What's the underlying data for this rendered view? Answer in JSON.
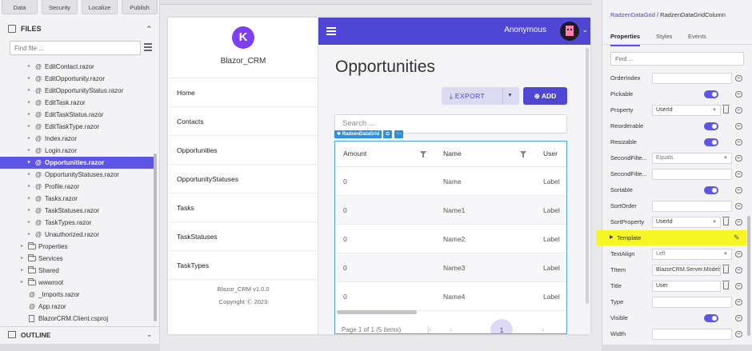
{
  "toolbar": {
    "data_label": "Data",
    "security_label": "Security",
    "localize_label": "Localize",
    "publish_label": "Publish"
  },
  "files": {
    "header": "FILES",
    "find_placeholder": "Find file ...",
    "items": [
      {
        "label": "EditContact.razor",
        "type": "razor"
      },
      {
        "label": "EditOpportunity.razor",
        "type": "razor"
      },
      {
        "label": "EditOpportunityStatus.razor",
        "type": "razor"
      },
      {
        "label": "EditTask.razor",
        "type": "razor"
      },
      {
        "label": "EditTaskStatus.razor",
        "type": "razor"
      },
      {
        "label": "EditTaskType.razor",
        "type": "razor"
      },
      {
        "label": "Index.razor",
        "type": "razor"
      },
      {
        "label": "Login.razor",
        "type": "razor"
      },
      {
        "label": "Opportunities.razor",
        "type": "razor",
        "selected": true
      },
      {
        "label": "OpportunityStatuses.razor",
        "type": "razor"
      },
      {
        "label": "Profile.razor",
        "type": "razor"
      },
      {
        "label": "Tasks.razor",
        "type": "razor"
      },
      {
        "label": "TaskStatuses.razor",
        "type": "razor"
      },
      {
        "label": "TaskTypes.razor",
        "type": "razor"
      },
      {
        "label": "Unauthorized.razor",
        "type": "razor"
      },
      {
        "label": "Properties",
        "type": "folder"
      },
      {
        "label": "Services",
        "type": "folder"
      },
      {
        "label": "Shared",
        "type": "folder"
      },
      {
        "label": "wwwroot",
        "type": "folder"
      },
      {
        "label": "_Imports.razor",
        "type": "root-razor"
      },
      {
        "label": "App.razor",
        "type": "root-razor"
      },
      {
        "label": "BlazorCRM.Client.csproj",
        "type": "file"
      }
    ]
  },
  "outline": {
    "header": "OUTLINE"
  },
  "app": {
    "logo_letter": "K",
    "brand": "Blazor_CRM",
    "nav": [
      "Home",
      "Contacts",
      "Opportunities",
      "OpportunityStatuses",
      "Tasks",
      "TaskStatuses",
      "TaskTypes"
    ],
    "version": "Blazor_CRM v1.0.0",
    "copyright": "Copyright Ⓒ 2023",
    "user": "Anonymous",
    "page_title": "Opportunities",
    "export_label": "EXPORT",
    "add_label": "ADD",
    "search_placeholder": "Search ...",
    "grid_badge": "RadzenDataGrid",
    "grid": {
      "columns": [
        "Amount",
        "Name",
        "User"
      ],
      "rows": [
        [
          "0",
          "Name",
          "Label"
        ],
        [
          "0",
          "Name1",
          "Label"
        ],
        [
          "0",
          "Name2",
          "Label"
        ],
        [
          "0",
          "Name3",
          "Label"
        ],
        [
          "0",
          "Name4",
          "Label"
        ]
      ],
      "pager_text": "Page 1 of 1 (5 items)",
      "page": "1"
    }
  },
  "props": {
    "breadcrumb_parent": "RadzenDataGrid",
    "breadcrumb_sep": "/",
    "breadcrumb_current": "RadzenDataGridColumn",
    "tabs": [
      "Properties",
      "Styles",
      "Events"
    ],
    "find_placeholder": "Find ...",
    "rows": [
      {
        "label": "OrderIndex",
        "kind": "input",
        "value": ""
      },
      {
        "label": "Pickable",
        "kind": "toggle"
      },
      {
        "label": "Property",
        "kind": "select",
        "value": "UserId",
        "trash": true
      },
      {
        "label": "Reorderable",
        "kind": "toggle"
      },
      {
        "label": "Resizable",
        "kind": "toggle"
      },
      {
        "label": "SecondFilte...",
        "kind": "select-grey",
        "value": "Equals"
      },
      {
        "label": "SecondFilte...",
        "kind": "input",
        "value": ""
      },
      {
        "label": "Sortable",
        "kind": "toggle"
      },
      {
        "label": "SortOrder",
        "kind": "input",
        "value": ""
      },
      {
        "label": "SortProperty",
        "kind": "select",
        "value": "UserId",
        "trash": true
      },
      {
        "label": "Template",
        "kind": "template"
      },
      {
        "label": "TextAlign",
        "kind": "select-grey",
        "value": "Left"
      },
      {
        "label": "TItem",
        "kind": "input-trash",
        "value": "BlazorCRM.Server.Models.I"
      },
      {
        "label": "Title",
        "kind": "input-trash",
        "value": "User"
      },
      {
        "label": "Type",
        "kind": "input",
        "value": ""
      },
      {
        "label": "Visible",
        "kind": "toggle"
      },
      {
        "label": "Width",
        "kind": "input",
        "value": ""
      }
    ]
  },
  "colors": {
    "accent": "#5c55e8",
    "header": "#4f46d6",
    "highlight": "#f6f624",
    "grid_outline": "#4aa1e6"
  }
}
